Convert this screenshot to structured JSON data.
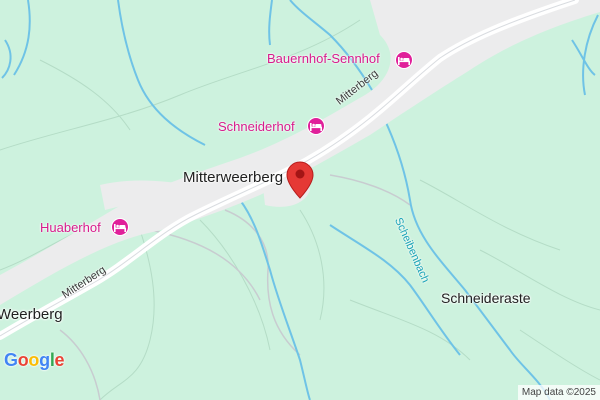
{
  "map": {
    "places": [
      {
        "id": "mitterweerberg",
        "label": "Mitterweerberg"
      },
      {
        "id": "weerberg",
        "label": "Weerberg"
      },
      {
        "id": "schneideraste",
        "label": "Schneideraste"
      }
    ],
    "pois": [
      {
        "id": "bauernhof-sennhof",
        "label": "Bauernhof-Sennhof",
        "icon": "hotel-icon"
      },
      {
        "id": "schneiderhof",
        "label": "Schneiderhof",
        "icon": "hotel-icon"
      },
      {
        "id": "huaberhof",
        "label": "Huaberhof",
        "icon": "hotel-icon"
      }
    ],
    "roads": [
      {
        "id": "mitterberg-upper",
        "label": "Mitterberg"
      },
      {
        "id": "mitterberg-lower",
        "label": "Mitterberg"
      }
    ],
    "streams": [
      {
        "id": "scheibenbach",
        "label": "Scheibenbach"
      }
    ],
    "marker": {
      "icon": "location-pin-icon",
      "color": "#e53935"
    },
    "colors": {
      "land": "#cdf2de",
      "road": "#ffffff",
      "water": "#6fc3e6",
      "poi": "#d81b8c"
    }
  },
  "branding": {
    "logo": "Google",
    "attribution": "Map data ©2025"
  }
}
